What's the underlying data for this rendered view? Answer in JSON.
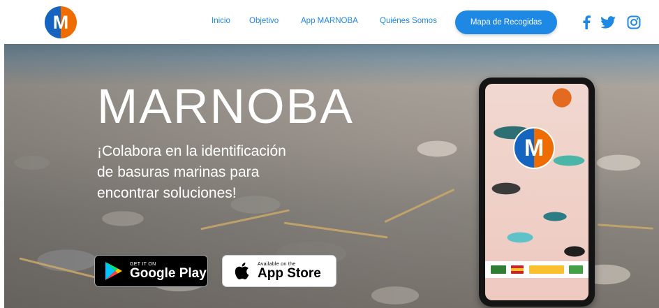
{
  "header": {
    "logo_letter": "M",
    "nav": [
      {
        "label": "Inicio"
      },
      {
        "label": "Objetivo"
      },
      {
        "label": "App MARNOBA"
      },
      {
        "label": "Quiénes Somos"
      }
    ],
    "cta_label": "Mapa de Recogidas",
    "social": [
      {
        "icon": "facebook-icon"
      },
      {
        "icon": "twitter-icon"
      },
      {
        "icon": "instagram-icon"
      }
    ]
  },
  "hero": {
    "title": "MARNOBA",
    "subtitle": "¡Colabora en la identificación de basuras marinas para encontrar soluciones!",
    "google_play": {
      "small": "GET IT ON",
      "big": "Google Play"
    },
    "app_store": {
      "small": "Available on the",
      "big": "App Store"
    },
    "phone_logo_letter": "M"
  },
  "colors": {
    "brand_blue": "#1e88e5",
    "logo_blue": "#1565c0",
    "logo_orange": "#ef6c00",
    "white": "#ffffff"
  }
}
